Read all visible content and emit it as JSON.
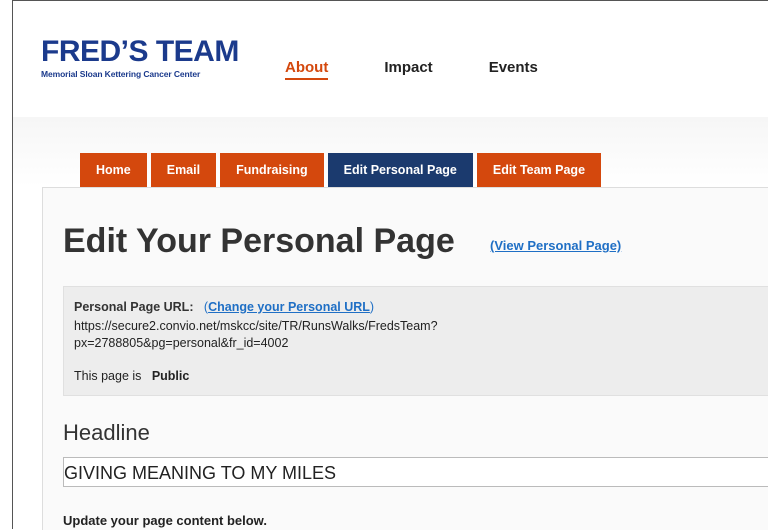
{
  "brand": {
    "name": "FRED’S TEAM",
    "subtitle": "Memorial Sloan Kettering Cancer Center",
    "color": "#1b3a8c"
  },
  "nav": {
    "items": [
      {
        "label": "About",
        "active": true
      },
      {
        "label": "Impact",
        "active": false
      },
      {
        "label": "Events",
        "active": false
      }
    ],
    "accent": "#d4480d"
  },
  "tabs": [
    {
      "label": "Home",
      "active": false
    },
    {
      "label": "Email",
      "active": false
    },
    {
      "label": "Fundraising",
      "active": false
    },
    {
      "label": "Edit Personal Page",
      "active": true
    },
    {
      "label": "Edit Team Page",
      "active": false
    }
  ],
  "page": {
    "title": "Edit Your Personal Page",
    "view_link": "(View Personal Page)"
  },
  "url_box": {
    "label": "Personal Page URL:",
    "change_link": "Change your Personal URL",
    "url": "https://secure2.convio.net/mskcc/site/TR/RunsWalks/FredsTeam?px=2788805&pg=personal&fr_id=4002",
    "status_prefix": "This page is",
    "status_value": "Public"
  },
  "headline": {
    "label": "Headline",
    "value": "GIVING MEANING TO MY MILES"
  },
  "content": {
    "update_label": "Update your page content below."
  }
}
